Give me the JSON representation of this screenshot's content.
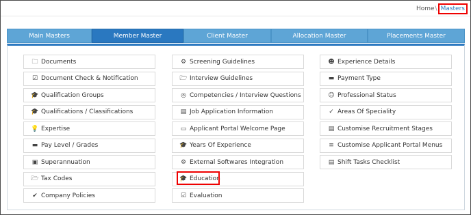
{
  "breadcrumb": {
    "home": "Home",
    "separator": "\\",
    "current": "Masters"
  },
  "tabs": [
    {
      "label": "Main Masters",
      "active": false
    },
    {
      "label": "Member Master",
      "active": true
    },
    {
      "label": "Client Master",
      "active": false
    },
    {
      "label": "Allocation Master",
      "active": false
    },
    {
      "label": "Placements Master",
      "active": false
    }
  ],
  "columns": [
    [
      {
        "label": "Documents",
        "icon": "folder-icon"
      },
      {
        "label": "Document Check & Notification",
        "icon": "checkbox-icon"
      },
      {
        "label": "Qualification Groups",
        "icon": "graduation-cap-icon"
      },
      {
        "label": "Qualifications / Classifications",
        "icon": "graduation-cap-icon"
      },
      {
        "label": "Expertise",
        "icon": "lightbulb-icon"
      },
      {
        "label": "Pay Level / Grades",
        "icon": "credit-card-icon"
      },
      {
        "label": "Superannuation",
        "icon": "money-icon"
      },
      {
        "label": "Tax Codes",
        "icon": "folder-open-icon"
      },
      {
        "label": "Company Policies",
        "icon": "check-circle-icon"
      }
    ],
    [
      {
        "label": "Screening Guidelines",
        "icon": "cogs-icon"
      },
      {
        "label": "Interview Guidelines",
        "icon": "folder-open-icon"
      },
      {
        "label": "Competencies / Interview Questions",
        "icon": "globe-icon"
      },
      {
        "label": "Job Application Information",
        "icon": "briefcase-icon"
      },
      {
        "label": "Applicant Portal Welcome Page",
        "icon": "monitor-icon"
      },
      {
        "label": "Years Of Experience",
        "icon": "graduation-cap-icon"
      },
      {
        "label": "External Softwares Integration",
        "icon": "gear-icon"
      },
      {
        "label": "Education",
        "icon": "graduation-cap-icon",
        "highlighted": true
      },
      {
        "label": "Evaluation",
        "icon": "checkbox-checked-icon"
      }
    ],
    [
      {
        "label": "Experience Details",
        "icon": "user-icon"
      },
      {
        "label": "Payment Type",
        "icon": "credit-card-icon"
      },
      {
        "label": "Professional Status",
        "icon": "user-outline-icon"
      },
      {
        "label": "Areas Of Speciality",
        "icon": "checkmark-icon"
      },
      {
        "label": "Customise Recruitment Stages",
        "icon": "briefcase-icon"
      },
      {
        "label": "Customise Applicant Portal Menus",
        "icon": "list-icon"
      },
      {
        "label": "Shift Tasks Checklist",
        "icon": "briefcase-icon"
      }
    ]
  ],
  "colors": {
    "active_tab": "#2a78c0",
    "tab": "#5ea5d6",
    "highlight": "#ee0000",
    "link": "#2f7bc0"
  }
}
